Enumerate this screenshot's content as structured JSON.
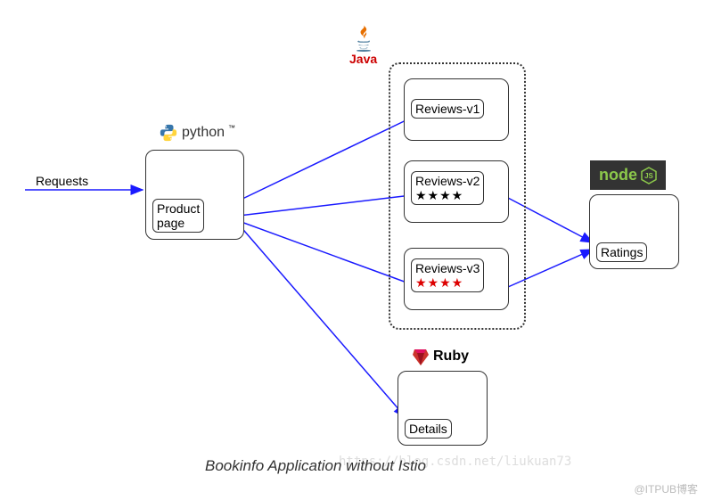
{
  "title": "Bookinfo Application without Istio",
  "request_label": "Requests",
  "services": {
    "product_page": {
      "label": "Product\npage",
      "tech": "python"
    },
    "reviews_v1": {
      "label": "Reviews-v1",
      "stars": ""
    },
    "reviews_v2": {
      "label": "Reviews-v2",
      "stars": "★★★★",
      "star_color": "#000"
    },
    "reviews_v3": {
      "label": "Reviews-v3",
      "stars": "★★★★",
      "star_color": "#d00"
    },
    "ratings": {
      "label": "Ratings",
      "tech": "node"
    },
    "details": {
      "label": "Details",
      "tech": "Ruby"
    }
  },
  "tech_labels": {
    "python": "python",
    "java": "Java",
    "ruby": "Ruby",
    "node": "node"
  },
  "watermark": "https://blog.csdn.net/liukuan73",
  "footer": "@ITPUB博客",
  "chart_data": {
    "type": "diagram",
    "nodes": [
      {
        "id": "requests",
        "label": "Requests",
        "type": "external"
      },
      {
        "id": "productpage",
        "label": "Product page",
        "tech": "python"
      },
      {
        "id": "reviews-v1",
        "label": "Reviews-v1",
        "tech": "java",
        "stars": null
      },
      {
        "id": "reviews-v2",
        "label": "Reviews-v2",
        "tech": "java",
        "stars": "black"
      },
      {
        "id": "reviews-v3",
        "label": "Reviews-v3",
        "tech": "java",
        "stars": "red"
      },
      {
        "id": "ratings",
        "label": "Ratings",
        "tech": "nodejs"
      },
      {
        "id": "details",
        "label": "Details",
        "tech": "ruby"
      }
    ],
    "edges": [
      {
        "from": "requests",
        "to": "productpage"
      },
      {
        "from": "productpage",
        "to": "reviews-v1"
      },
      {
        "from": "productpage",
        "to": "reviews-v2"
      },
      {
        "from": "productpage",
        "to": "reviews-v3"
      },
      {
        "from": "productpage",
        "to": "details"
      },
      {
        "from": "reviews-v2",
        "to": "ratings"
      },
      {
        "from": "reviews-v3",
        "to": "ratings"
      }
    ],
    "groups": [
      {
        "label": "Java",
        "members": [
          "reviews-v1",
          "reviews-v2",
          "reviews-v3"
        ]
      }
    ],
    "title": "Bookinfo Application without Istio"
  }
}
